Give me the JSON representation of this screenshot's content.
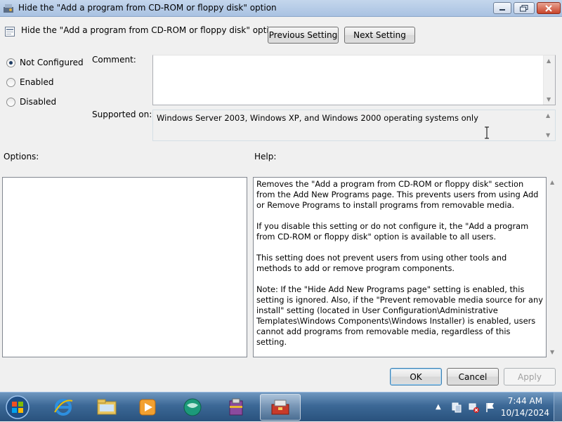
{
  "window": {
    "title": "Hide the \"Add a program from CD-ROM or floppy disk\" option"
  },
  "header": {
    "setting_name": "Hide the \"Add a program from CD-ROM or floppy disk\" option",
    "previous_label": "Previous Setting",
    "next_label": "Next Setting"
  },
  "state": {
    "options": [
      {
        "label": "Not Configured",
        "selected": true
      },
      {
        "label": "Enabled",
        "selected": false
      },
      {
        "label": "Disabled",
        "selected": false
      }
    ]
  },
  "comment": {
    "label": "Comment:",
    "value": ""
  },
  "supported": {
    "label": "Supported on:",
    "value": "Windows Server 2003, Windows XP, and Windows 2000 operating systems only"
  },
  "options_panel": {
    "label": "Options:"
  },
  "help": {
    "label": "Help:",
    "paragraphs": [
      "Removes the \"Add a program from CD-ROM or floppy disk\" section from the Add New Programs page. This prevents users from using Add or Remove Programs to install programs from removable media.",
      "If you disable this setting or do not configure it, the \"Add a program from CD-ROM or floppy disk\" option is available to all users.",
      "This setting does not prevent users from using other tools and methods to add or remove program components.",
      "Note: If the \"Hide Add New Programs page\" setting is enabled, this setting is ignored. Also, if the \"Prevent removable media source for any install\" setting (located in User Configuration\\Administrative Templates\\Windows Components\\Windows Installer) is enabled, users cannot add programs from removable media, regardless of this setting."
    ]
  },
  "footer": {
    "ok_label": "OK",
    "cancel_label": "Cancel",
    "apply_label": "Apply"
  },
  "taskbar": {
    "items": [
      {
        "icon": "start-orb-icon"
      },
      {
        "icon": "internet-explorer-icon"
      },
      {
        "icon": "file-explorer-icon"
      },
      {
        "icon": "media-player-icon"
      },
      {
        "icon": "network-globe-icon"
      },
      {
        "icon": "archive-tool-icon"
      },
      {
        "icon": "group-policy-icon",
        "active": true
      }
    ],
    "time": "7:44 AM",
    "date": "10/14/2024"
  },
  "colors": {
    "accent": "#3c7fb1",
    "taskbar": "#3c6896"
  }
}
